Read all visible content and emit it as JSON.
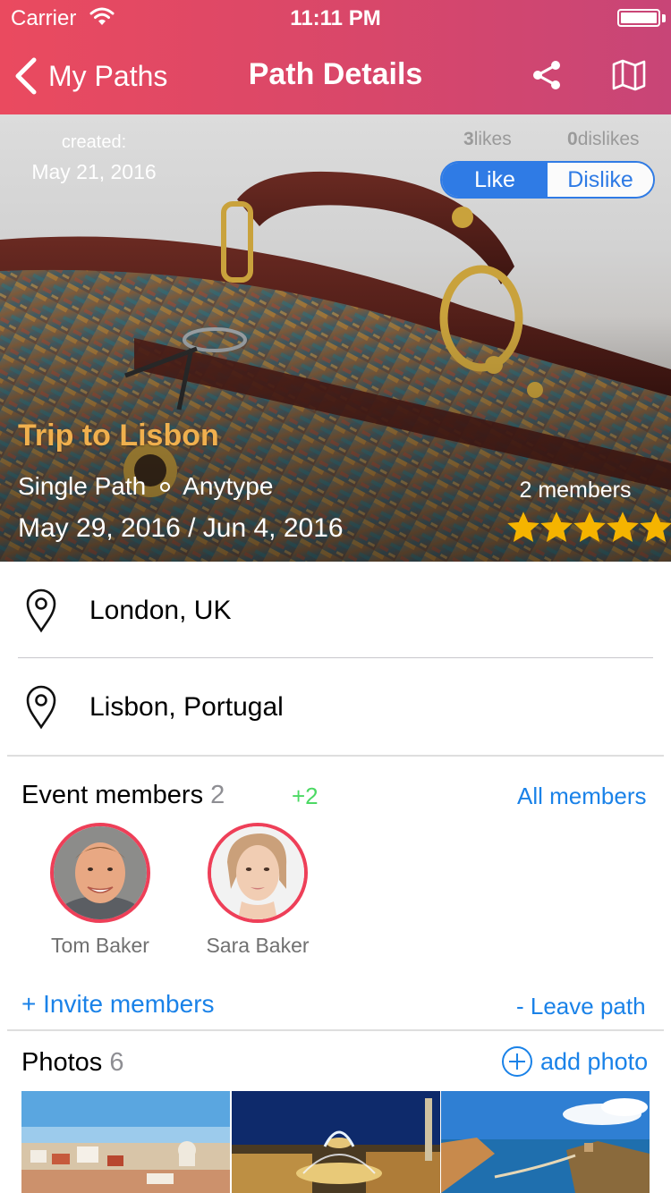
{
  "status_bar": {
    "carrier": "Carrier",
    "time": "11:11 PM"
  },
  "nav": {
    "back_label": "My Paths",
    "title": "Path Details",
    "icons": [
      "share-icon",
      "map-icon"
    ]
  },
  "hero": {
    "created_label": "created:",
    "created_date": "May 21, 2016",
    "likes_count": "3",
    "likes_label": "likes",
    "dislikes_count": "0",
    "dislikes_label": "dislikes",
    "like_button": "Like",
    "dislike_button": "Dislike",
    "selected_vote": "Like",
    "trip_title": "Trip to Lisbon",
    "path_type": "Single Path",
    "path_kind": "Anytype",
    "dates": "May 29, 2016 / Jun 4, 2016",
    "members": "2 members",
    "rating_stars": 5,
    "rating_max": 5
  },
  "locations": [
    {
      "label": "London, UK"
    },
    {
      "label": "Lisbon, Portugal"
    }
  ],
  "members_section": {
    "title": "Event members",
    "count": "2",
    "extra": "+2",
    "all_link": "All members",
    "members": [
      {
        "name": "Tom Baker"
      },
      {
        "name": "Sara Baker"
      }
    ],
    "invite": "+ Invite members",
    "leave": "- Leave path"
  },
  "photos_section": {
    "title": "Photos",
    "count": "6",
    "add_label": "add photo"
  },
  "colors": {
    "header_start": "#ea4a5f",
    "header_end": "#c84577",
    "accent_blue": "#1a82e8",
    "trip_title": "#f0b04e",
    "plus_green": "#4cd964",
    "avatar_ring": "#ee3f58",
    "star": "#f5b400"
  }
}
